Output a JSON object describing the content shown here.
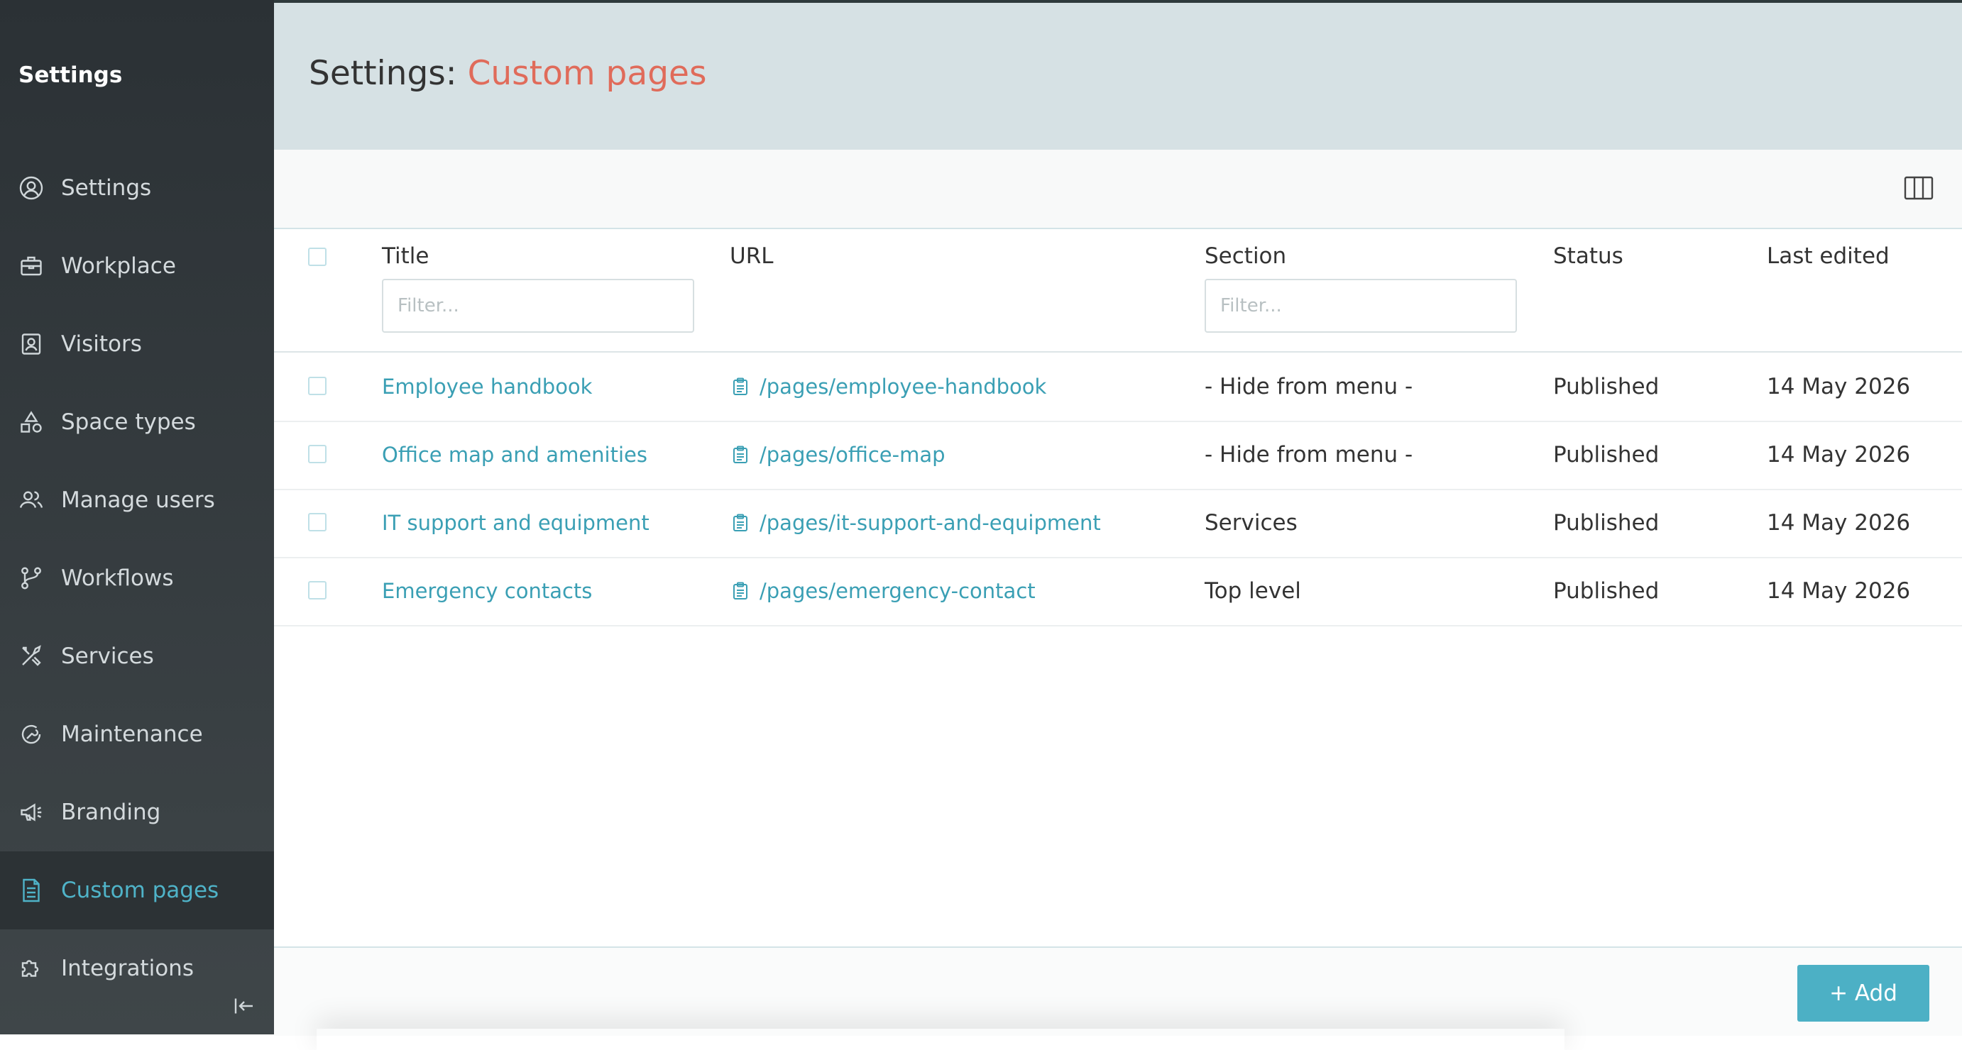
{
  "sidebar": {
    "title": "Settings",
    "items": [
      {
        "label": "Settings",
        "icon": "user-circle-icon"
      },
      {
        "label": "Workplace",
        "icon": "briefcase-icon"
      },
      {
        "label": "Visitors",
        "icon": "badge-icon"
      },
      {
        "label": "Space types",
        "icon": "shapes-icon"
      },
      {
        "label": "Manage users",
        "icon": "users-icon"
      },
      {
        "label": "Workflows",
        "icon": "workflow-icon"
      },
      {
        "label": "Services",
        "icon": "tools-icon"
      },
      {
        "label": "Maintenance",
        "icon": "wrench-icon"
      },
      {
        "label": "Branding",
        "icon": "megaphone-icon"
      },
      {
        "label": "Custom pages",
        "icon": "document-icon",
        "active": true
      },
      {
        "label": "Integrations",
        "icon": "puzzle-icon"
      }
    ]
  },
  "header": {
    "title_prefix": "Settings: ",
    "title_accent": "Custom pages"
  },
  "table": {
    "columns": {
      "title": "Title",
      "url": "URL",
      "section": "Section",
      "status": "Status",
      "last_edited": "Last edited"
    },
    "filter_placeholder": "Filter...",
    "rows": [
      {
        "title": "Employee handbook",
        "url": "/pages/employee-handbook",
        "section": "- Hide from menu -",
        "status": "Published",
        "last_edited": "14 May 2026"
      },
      {
        "title": "Office map and amenities",
        "url": "/pages/office-map",
        "section": "- Hide from menu -",
        "status": "Published",
        "last_edited": "14 May 2026"
      },
      {
        "title": "IT support and equipment",
        "url": "/pages/it-support-and-equipment",
        "section": "Services",
        "status": "Published",
        "last_edited": "14 May 2026"
      },
      {
        "title": "Emergency contacts",
        "url": "/pages/emergency-contact",
        "section": "Top level",
        "status": "Published",
        "last_edited": "14 May 2026"
      }
    ]
  },
  "footer": {
    "add_label": "+ Add"
  },
  "colors": {
    "accent": "#4cb0c5",
    "title_accent": "#e06b5a",
    "sidebar_bg": "#3a4144"
  }
}
